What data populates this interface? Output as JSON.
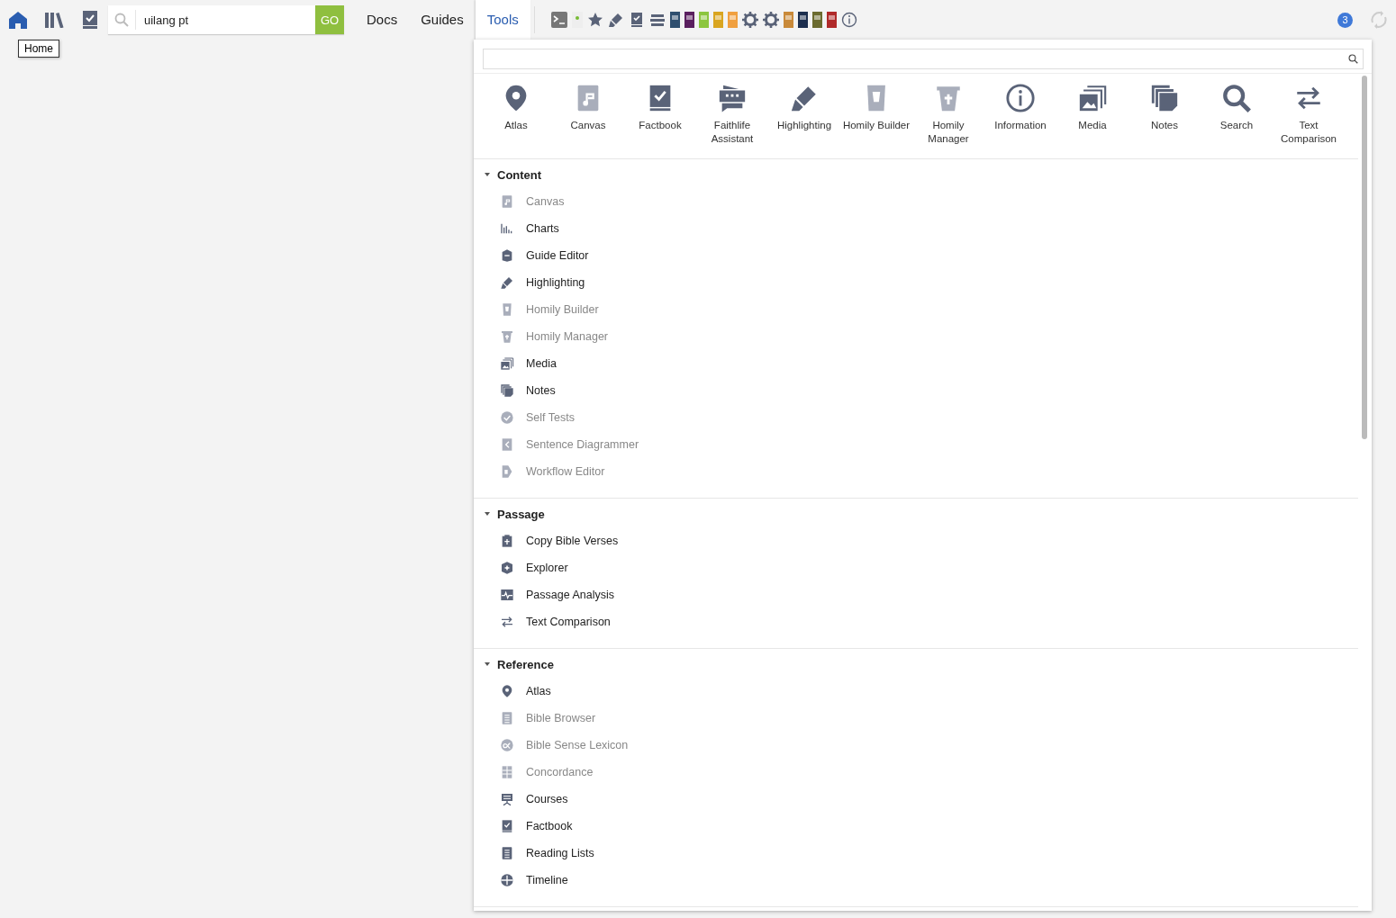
{
  "toolbar": {
    "search": {
      "value": "uilang pt"
    },
    "go_button": "GO",
    "tabs": [
      {
        "label": "Docs",
        "selected": false
      },
      {
        "label": "Guides",
        "selected": false
      },
      {
        "label": "Tools",
        "selected": true
      }
    ],
    "notification_count": "3"
  },
  "tooltip": "Home",
  "tools_panel": {
    "featured": [
      {
        "label": "Atlas",
        "kind": "pin",
        "disabled": false
      },
      {
        "label": "Canvas",
        "kind": "canvas",
        "disabled": true
      },
      {
        "label": "Factbook",
        "kind": "checkbook",
        "disabled": false
      },
      {
        "label": "Faithlife Assistant",
        "kind": "chat",
        "disabled": false
      },
      {
        "label": "Highlighting",
        "kind": "marker",
        "disabled": false
      },
      {
        "label": "Homily Builder",
        "kind": "cup",
        "disabled": true
      },
      {
        "label": "Homily Manager",
        "kind": "crosscup",
        "disabled": true
      },
      {
        "label": "Information",
        "kind": "info",
        "disabled": false
      },
      {
        "label": "Media",
        "kind": "images",
        "disabled": false
      },
      {
        "label": "Notes",
        "kind": "pages",
        "disabled": false
      },
      {
        "label": "Search",
        "kind": "search",
        "disabled": false
      },
      {
        "label": "Text Comparison",
        "kind": "arrows",
        "disabled": false
      }
    ],
    "sections": [
      {
        "title": "Content",
        "expanded": true,
        "items": [
          {
            "label": "Canvas",
            "kind": "canvas",
            "disabled": true
          },
          {
            "label": "Charts",
            "kind": "bars",
            "disabled": false
          },
          {
            "label": "Guide Editor",
            "kind": "guide",
            "disabled": false
          },
          {
            "label": "Highlighting",
            "kind": "marker",
            "disabled": false
          },
          {
            "label": "Homily Builder",
            "kind": "cup",
            "disabled": true
          },
          {
            "label": "Homily Manager",
            "kind": "crosscup",
            "disabled": true
          },
          {
            "label": "Media",
            "kind": "images",
            "disabled": false
          },
          {
            "label": "Notes",
            "kind": "pages",
            "disabled": false
          },
          {
            "label": "Self Tests",
            "kind": "checkcircle",
            "disabled": true
          },
          {
            "label": "Sentence Diagrammer",
            "kind": "diagram",
            "disabled": true
          },
          {
            "label": "Workflow Editor",
            "kind": "tag",
            "disabled": true
          }
        ]
      },
      {
        "title": "Passage",
        "expanded": true,
        "items": [
          {
            "label": "Copy Bible Verses",
            "kind": "clipboard",
            "disabled": false
          },
          {
            "label": "Explorer",
            "kind": "shield",
            "disabled": false
          },
          {
            "label": "Passage Analysis",
            "kind": "pulse",
            "disabled": false
          },
          {
            "label": "Text Comparison",
            "kind": "arrows",
            "disabled": false
          }
        ]
      },
      {
        "title": "Reference",
        "expanded": true,
        "items": [
          {
            "label": "Atlas",
            "kind": "pin",
            "disabled": false
          },
          {
            "label": "Bible Browser",
            "kind": "list",
            "disabled": true
          },
          {
            "label": "Bible Sense Lexicon",
            "kind": "alpha",
            "disabled": true
          },
          {
            "label": "Concordance",
            "kind": "grid",
            "disabled": true
          },
          {
            "label": "Courses",
            "kind": "easel",
            "disabled": false
          },
          {
            "label": "Factbook",
            "kind": "checkbook",
            "disabled": false
          },
          {
            "label": "Reading Lists",
            "kind": "list",
            "disabled": false
          },
          {
            "label": "Timeline",
            "kind": "globe",
            "disabled": false
          }
        ]
      }
    ]
  }
}
